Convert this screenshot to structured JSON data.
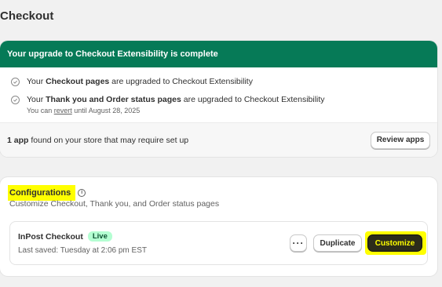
{
  "page": {
    "title": "Checkout"
  },
  "upgrade": {
    "banner": "Your upgrade to Checkout Extensibility is complete",
    "items": [
      {
        "prefix": "Your ",
        "bold": "Checkout pages",
        "suffix": " are upgraded to Checkout Extensibility"
      },
      {
        "prefix": "Your ",
        "bold": "Thank you and Order status pages",
        "suffix": " are upgraded to Checkout Extensibility"
      }
    ],
    "revert_note": {
      "prefix": "You can ",
      "link": "revert",
      "suffix": " until August 28, 2025"
    },
    "apps": {
      "count": "1 app",
      "text": " found on your store that may require set up",
      "button": "Review apps"
    }
  },
  "configurations": {
    "title": "Configurations",
    "info_icon": "i",
    "description": "Customize Checkout, Thank you, and Order status pages",
    "checkout": {
      "name": "InPost Checkout",
      "badge": "Live",
      "last_saved": "Last saved: Tuesday at 2:06 pm EST",
      "more_label": "···",
      "duplicate_label": "Duplicate",
      "customize_label": "Customize"
    }
  },
  "colors": {
    "banner": "#067a57",
    "live_badge": "#b4fed2",
    "highlight": "#ffff00"
  }
}
